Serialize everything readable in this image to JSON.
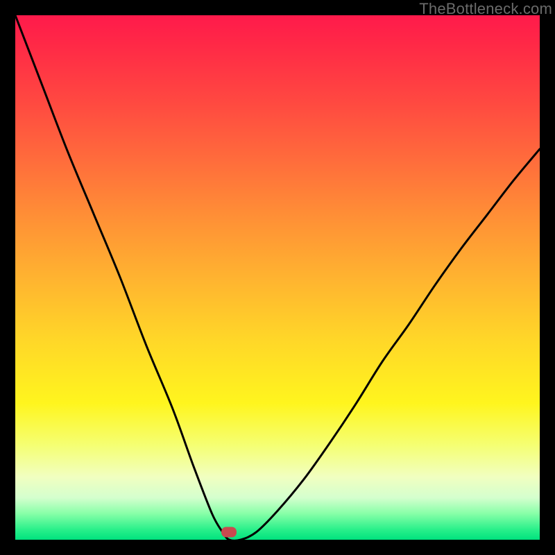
{
  "watermark": "TheBottleneck.com",
  "marker": {
    "x_frac": 0.408,
    "y_frac": 0.985
  },
  "chart_data": {
    "type": "line",
    "title": "",
    "xlabel": "",
    "ylabel": "",
    "xlim": [
      0,
      1
    ],
    "ylim": [
      0,
      1
    ],
    "series": [
      {
        "name": "curve",
        "x": [
          0.0,
          0.05,
          0.1,
          0.15,
          0.2,
          0.25,
          0.3,
          0.34,
          0.375,
          0.395,
          0.408,
          0.43,
          0.46,
          0.5,
          0.55,
          0.6,
          0.65,
          0.7,
          0.75,
          0.8,
          0.85,
          0.9,
          0.95,
          1.0
        ],
        "y": [
          1.0,
          0.87,
          0.74,
          0.62,
          0.5,
          0.37,
          0.25,
          0.14,
          0.05,
          0.015,
          0.0,
          0.0,
          0.015,
          0.055,
          0.115,
          0.185,
          0.26,
          0.34,
          0.41,
          0.485,
          0.555,
          0.62,
          0.685,
          0.745
        ]
      }
    ],
    "marker": {
      "x": 0.408,
      "y": 0.0
    },
    "background_gradient": {
      "top": "#ff1a4b",
      "middle": "#ffd728",
      "bottom": "#00e27e"
    }
  }
}
